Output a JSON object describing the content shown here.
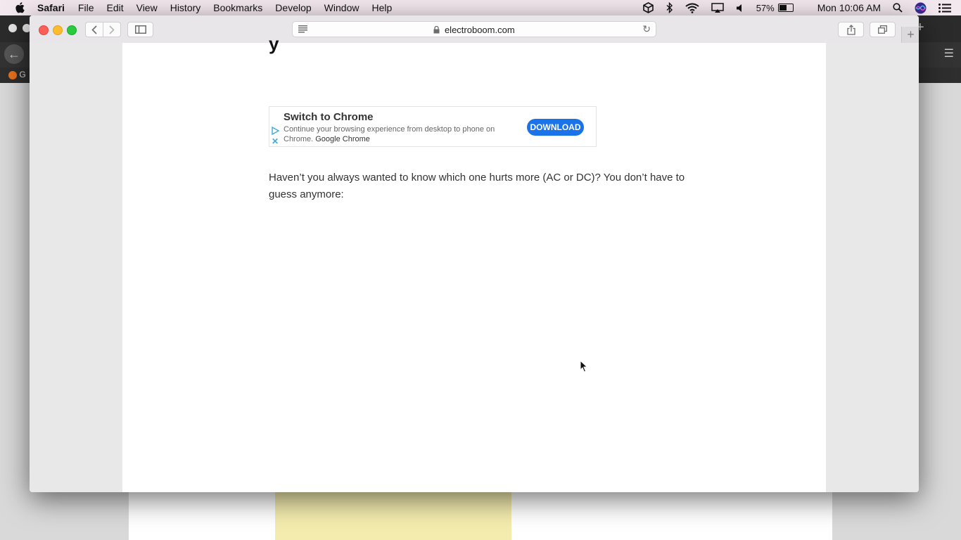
{
  "menubar": {
    "app": "Safari",
    "items": [
      "File",
      "Edit",
      "View",
      "History",
      "Bookmarks",
      "Develop",
      "Window",
      "Help"
    ],
    "battery": "57%",
    "clock": "Mon 10:06 AM",
    "icons": [
      "dropbox-icon",
      "bluetooth-icon",
      "wifi-icon",
      "airplay-icon",
      "volume-icon",
      "battery-icon",
      "spotlight-icon",
      "siri-icon",
      "notification-center-icon"
    ]
  },
  "background_window": {
    "bookmark_text": "G"
  },
  "safari": {
    "url": "electroboom.com",
    "new_tab_glyph": "+"
  },
  "page": {
    "heading_fragment": "y",
    "ad": {
      "title": "Switch to Chrome",
      "description": "Continue your browsing experience from desktop to phone on Chrome.",
      "advertiser": "Google Chrome",
      "button": "DOWNLOAD",
      "accent": "#1a73e8"
    },
    "paragraph": "Haven’t you always wanted to know which one hurts more (AC or DC)? You don’t have to guess anymore:"
  }
}
